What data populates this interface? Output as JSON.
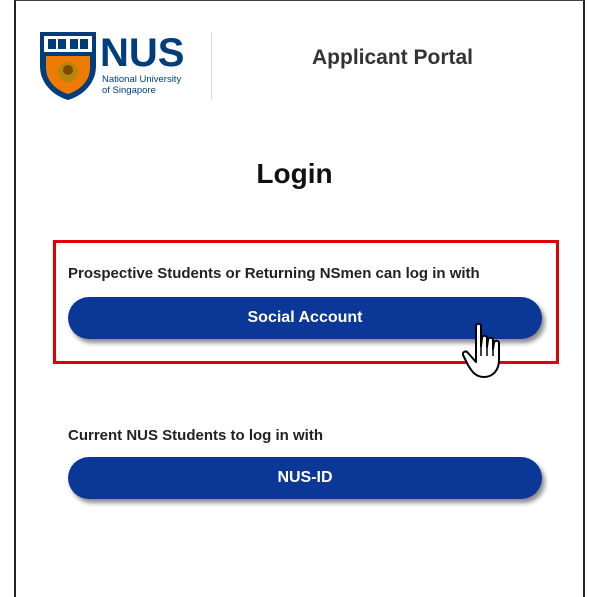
{
  "header": {
    "logo": {
      "wordmark": "NUS",
      "line1": "National University",
      "line2": "of Singapore"
    },
    "portal_title": "Applicant Portal"
  },
  "login": {
    "heading": "Login",
    "social": {
      "prompt": "Prospective Students or Returning NSmen can log in with",
      "button_label": "Social Account"
    },
    "nusid": {
      "prompt": "Current NUS Students to log in with",
      "button_label": "NUS-ID"
    }
  },
  "colors": {
    "button": "#0b3796",
    "highlight": "#e00000",
    "brand_blue": "#003d7c",
    "brand_orange": "#ef7c00"
  },
  "icons": [
    "nus-crest-icon",
    "hand-pointer-icon"
  ]
}
